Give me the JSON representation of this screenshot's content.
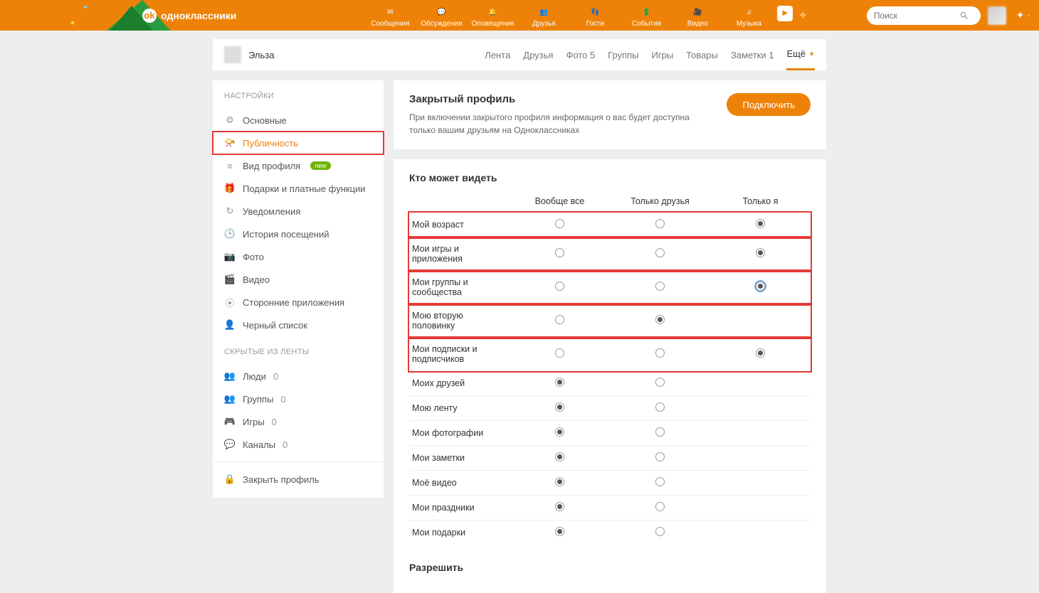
{
  "brand": "одноклассники",
  "header_nav": [
    {
      "label": "Сообщения"
    },
    {
      "label": "Обсуждения"
    },
    {
      "label": "Оповещения"
    },
    {
      "label": "Друзья"
    },
    {
      "label": "Гости"
    },
    {
      "label": "События"
    },
    {
      "label": "Видео"
    },
    {
      "label": "Музыка"
    }
  ],
  "search": {
    "placeholder": "Поиск"
  },
  "user": {
    "name": "Эльза"
  },
  "subtabs": [
    {
      "label": "Лента"
    },
    {
      "label": "Друзья"
    },
    {
      "label": "Фото 5"
    },
    {
      "label": "Группы"
    },
    {
      "label": "Игры"
    },
    {
      "label": "Товары"
    },
    {
      "label": "Заметки 1"
    },
    {
      "label": "Ещё",
      "active": true,
      "caret": true
    }
  ],
  "sidebar": {
    "title": "НАСТРОЙКИ",
    "items": [
      {
        "label": "Основные"
      },
      {
        "label": "Публичность",
        "active": true,
        "highlight": true
      },
      {
        "label": "Вид профиля",
        "badge": "new"
      },
      {
        "label": "Подарки и платные функции"
      },
      {
        "label": "Уведомления"
      },
      {
        "label": "История посещений"
      },
      {
        "label": "Фото"
      },
      {
        "label": "Видео"
      },
      {
        "label": "Сторонние приложения"
      },
      {
        "label": "Черный список"
      }
    ],
    "hidden_title": "СКРЫТЫЕ ИЗ ЛЕНТЫ",
    "hidden": [
      {
        "label": "Люди",
        "count": "0"
      },
      {
        "label": "Группы",
        "count": "0"
      },
      {
        "label": "Игры",
        "count": "0"
      },
      {
        "label": "Каналы",
        "count": "0"
      }
    ],
    "close_profile": "Закрыть профиль"
  },
  "promo": {
    "title": "Закрытый профиль",
    "desc": "При включении закрытого профиля информация о вас будет доступна только вашим друзьям на Одноклассниках",
    "button": "Подключить"
  },
  "privacy": {
    "title": "Кто может видеть",
    "cols": [
      "Вообще все",
      "Только друзья",
      "Только я"
    ],
    "rows": [
      {
        "label": "Мой возраст",
        "sel": 2,
        "hl": true
      },
      {
        "label": "Мои игры и приложения",
        "sel": 2,
        "hl": true
      },
      {
        "label": "Мои группы и сообщества",
        "sel": 2,
        "hl": true,
        "focused": true
      },
      {
        "label": "Мою вторую половинку",
        "sel": 1,
        "hl": true,
        "cells": 2
      },
      {
        "label": "Мои подписки и подписчиков",
        "sel": 2,
        "hl": true
      },
      {
        "label": "Моих друзей",
        "sel": 0,
        "cells": 2
      },
      {
        "label": "Мою ленту",
        "sel": 0,
        "cells": 2
      },
      {
        "label": "Мои фотографии",
        "sel": 0,
        "cells": 2
      },
      {
        "label": "Мои заметки",
        "sel": 0,
        "cells": 2
      },
      {
        "label": "Моё видео",
        "sel": 0,
        "cells": 2
      },
      {
        "label": "Мои праздники",
        "sel": 0,
        "cells": 2
      },
      {
        "label": "Мои подарки",
        "sel": 0,
        "cells": 2
      }
    ]
  },
  "allow_title": "Разрешить"
}
